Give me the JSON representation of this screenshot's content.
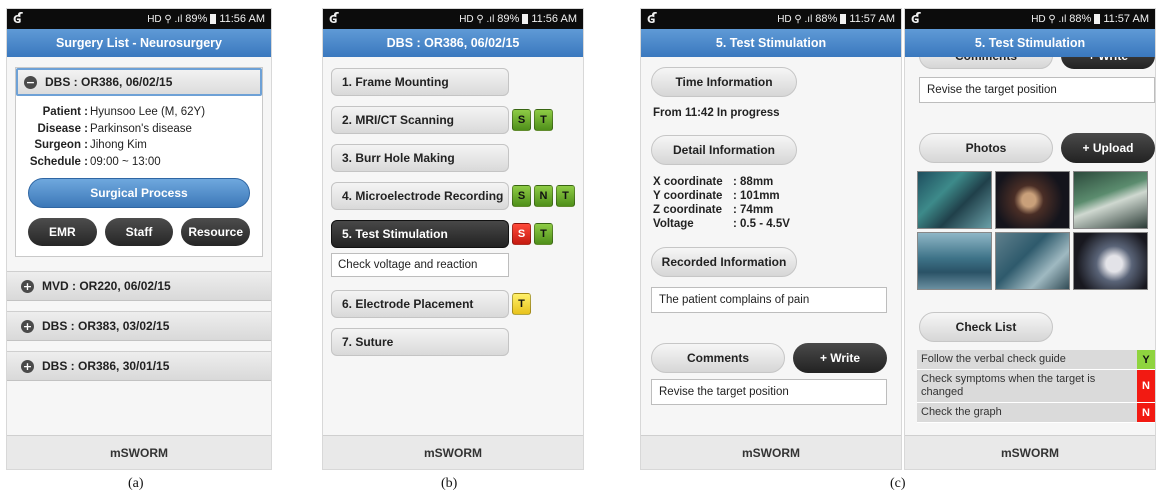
{
  "status": {
    "s1": {
      "logo": "ʛ",
      "signal": "HD ⚲ .ıl",
      "battery": "89%",
      "time": "11:56 AM"
    },
    "s2": {
      "logo": "ʛ",
      "signal": "HD ⚲ .ıl",
      "battery": "89%",
      "time": "11:56 AM"
    },
    "s3": {
      "logo": "ʛ",
      "signal": "HD ⚲ .ıl",
      "battery": "88%",
      "time": "11:57 AM"
    },
    "s4": {
      "logo": "ʛ",
      "signal": "HD ⚲ .ıl",
      "battery": "88%",
      "time": "11:57 AM"
    }
  },
  "screen1": {
    "title": "Surgery  List  -  Neurosurgery",
    "open_case": {
      "toggle": "−",
      "label": "DBS : OR386, 06/02/15",
      "patient_k": "Patient",
      "patient_v": "Hyunsoo Lee (M, 62Y)",
      "disease_k": "Disease",
      "disease_v": "Parkinson's disease",
      "surgeon_k": "Surgeon",
      "surgeon_v": "Jihong Kim",
      "schedule_k": "Schedule",
      "schedule_v": "09:00 ~ 13:00",
      "process_btn": "Surgical Process",
      "emr_btn": "EMR",
      "staff_btn": "Staff",
      "resource_btn": "Resource"
    },
    "cases": [
      {
        "toggle": "+",
        "label": "MVD : OR220, 06/02/15"
      },
      {
        "toggle": "+",
        "label": "DBS : OR383, 03/02/15"
      },
      {
        "toggle": "+",
        "label": "DBS : OR386, 30/01/15"
      }
    ],
    "footer": "mSWORM"
  },
  "screen2": {
    "title": "DBS : OR386, 06/02/15",
    "steps": [
      {
        "label": "1. Frame Mounting"
      },
      {
        "label": "2. MRI/CT Scanning",
        "badges": [
          "S",
          "T"
        ]
      },
      {
        "label": "3. Burr Hole Making"
      },
      {
        "label": "4. Microelectrode Recording",
        "badges": [
          "S",
          "N",
          "T"
        ]
      },
      {
        "label": "5. Test Stimulation",
        "badges": [
          "S",
          "T"
        ],
        "note": "Check voltage and reaction"
      },
      {
        "label": "6. Electrode Placement",
        "badges": [
          "T"
        ]
      },
      {
        "label": "7. Suture"
      }
    ],
    "footer": "mSWORM"
  },
  "screen3": {
    "title": "5. Test Stimulation",
    "time_btn": "Time Information",
    "time_text": "From 11:42  In progress",
    "detail_btn": "Detail Information",
    "x_k": "X coordinate",
    "x_v": ": 88mm",
    "y_k": "Y coordinate",
    "y_v": ": 101mm",
    "z_k": "Z coordinate",
    "z_v": ": 74mm",
    "volt_k": "Voltage",
    "volt_v": ": 0.5 - 4.5V",
    "recorded_btn": "Recorded Information",
    "recorded_text": "The patient complains of pain",
    "comments_btn": "Comments",
    "write_btn": "+  Write",
    "comment_text": "Revise the target position",
    "footer": "mSWORM"
  },
  "screen4": {
    "title": "5. Test Stimulation",
    "comments_btn": "Comments",
    "write_btn": "+  Write",
    "comment_text": "Revise the target position",
    "photos_btn": "Photos",
    "upload_btn": "+  Upload",
    "checklist_btn": "Check List",
    "checklist": [
      {
        "text": "Follow the verbal check guide",
        "flag": "Y"
      },
      {
        "text": "Check symptoms when the target is changed",
        "flag": "N"
      },
      {
        "text": "Check the graph",
        "flag": "N"
      }
    ],
    "footer": "mSWORM"
  },
  "captions": {
    "a": "(a)",
    "b": "(b)",
    "c": "(c)"
  },
  "colors": {
    "appbar": "#3a78be",
    "badge_green": "#6aa52c",
    "badge_red": "#e0261a",
    "badge_yellow": "#f5dc3a",
    "flag_yes": "#8fd43f",
    "flag_no": "#f21a12"
  }
}
